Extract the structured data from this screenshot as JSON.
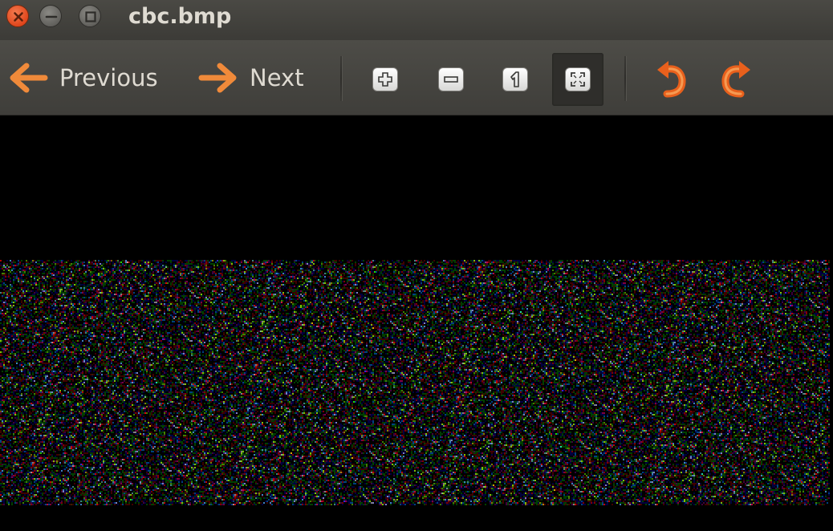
{
  "window": {
    "title": "cbc.bmp",
    "controls": [
      "close-icon",
      "minimize-icon",
      "maximize-icon"
    ],
    "accent_close": "#e0461c"
  },
  "toolbar": {
    "previous_label": "Previous",
    "next_label": "Next",
    "arrow_color": "#f08a3a",
    "tools": [
      {
        "name": "zoom-in",
        "icon": "plus-icon",
        "active": false
      },
      {
        "name": "zoom-out",
        "icon": "minus-icon",
        "active": false
      },
      {
        "name": "normal-size",
        "icon": "one-icon",
        "active": false
      },
      {
        "name": "best-fit",
        "icon": "fit-icon",
        "active": true
      }
    ],
    "rotate": [
      {
        "name": "rotate-left",
        "icon": "rotate-left-icon"
      },
      {
        "name": "rotate-right",
        "icon": "rotate-right-icon"
      }
    ]
  },
  "viewer": {
    "background": "#000000",
    "image_content": "random-noise"
  }
}
